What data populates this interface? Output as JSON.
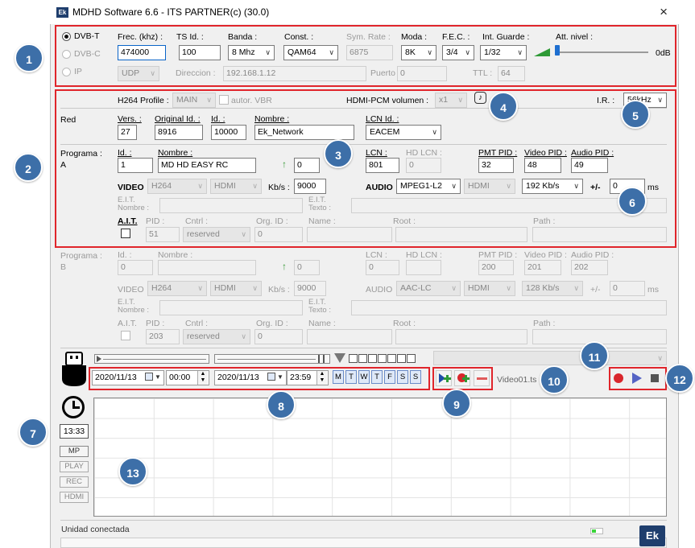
{
  "window": {
    "title": "MDHD Software 6.6 - ITS PARTNER(c) (30.0)",
    "logo": "Ek",
    "close": "×"
  },
  "badges": [
    "1",
    "2",
    "3",
    "4",
    "5",
    "6",
    "7",
    "8",
    "9",
    "10",
    "11",
    "12",
    "13"
  ],
  "tuner": {
    "modes": [
      "DVB-T",
      "DVB-C",
      "IP"
    ],
    "frec_label": "Frec. (khz) :",
    "frec_value": "474000",
    "ts_label": "TS Id. :",
    "ts_value": "100",
    "banda_label": "Banda :",
    "banda_value": "8 Mhz",
    "const_label": "Const. :",
    "const_value": "QAM64",
    "symrate_label": "Sym. Rate :",
    "symrate_value": "6875",
    "moda_label": "Moda :",
    "moda_value": "8K",
    "fec_label": "F.E.C. :",
    "fec_value": "3/4",
    "guard_label": "Int. Guarde :",
    "guard_value": "1/32",
    "att_label": "Att. nivel :",
    "att_value": "0dB",
    "att_level": 0,
    "proto_value": "UDP",
    "direccion_label": "Direccion :",
    "direccion_value": "192.168.1.12",
    "puerto_label": "Puerto",
    "puerto_value": "0",
    "ttl_label": "TTL :",
    "ttl_value": "64"
  },
  "encoder": {
    "h264_label": "H264 Profile :",
    "h264_value": "MAIN",
    "vbr_label": "autor. VBR",
    "hdmipcm_label": "HDMI-PCM volumen :",
    "hdmipcm_value": "x1",
    "ir_label": "I.R. :",
    "ir_value": "56kHz"
  },
  "red": {
    "label": "Red",
    "vers_label": "Vers. :",
    "vers_value": "27",
    "orig_label": "Original Id. :",
    "orig_value": "8916",
    "id_label": "Id. :",
    "id_value": "10000",
    "nombre_label": "Nombre :",
    "nombre_value": "Ek_Network",
    "lcnid_label": "LCN Id. :",
    "lcnid_value": "EACEM"
  },
  "programa_a": {
    "label": "Programa :",
    "letter": "A",
    "id_label": "Id. :",
    "id_value": "1",
    "nombre_label": "Nombre :",
    "nombre_value": "MD HD EASY RC",
    "extra_value": "0",
    "lcn_label": "LCN :",
    "lcn_value": "801",
    "hdlcn_label": "HD LCN :",
    "hdlcn_value": "0",
    "pmt_label": "PMT PID :",
    "pmt_value": "32",
    "video_pid_label": "Video PID :",
    "video_pid_value": "48",
    "audio_pid_label": "Audio PID :",
    "audio_pid_value": "49",
    "video_label": "VIDEO",
    "video_codec": "H264",
    "video_src": "HDMI",
    "kbs_label": "Kb/s :",
    "kbs_value": "9000",
    "audio_label": "AUDIO",
    "audio_codec": "MPEG1-L2",
    "audio_src": "HDMI",
    "audio_rate": "192 Kb/s",
    "pm_label": "+/-",
    "pm_value": "0",
    "ms_label": "ms",
    "eit_nombre": "E.I.T.\nNombre :",
    "eit_texto": "E.I.T.\nTexto :",
    "ait_label": "A.I.T.",
    "pid_label": "PID :",
    "pid_value": "51",
    "cntrl_label": "Cntrl :",
    "cntrl_value": "reserved",
    "org_label": "Org. ID :",
    "org_value": "0",
    "name_label": "Name :",
    "root_label": "Root :",
    "path_label": "Path :"
  },
  "programa_b": {
    "label": "Programa :",
    "letter": "B",
    "id_label": "Id. :",
    "id_value": "0",
    "nombre_label": "Nombre :",
    "extra_value": "0",
    "lcn_label": "LCN :",
    "lcn_value": "0",
    "hdlcn_label": "HD LCN :",
    "pmt_label": "PMT PID :",
    "pmt_value": "200",
    "video_pid_label": "Video PID :",
    "video_pid_value": "201",
    "audio_pid_label": "Audio PID :",
    "audio_pid_value": "202",
    "video_label": "VIDEO",
    "video_codec": "H264",
    "video_src": "HDMI",
    "kbs_label": "Kb/s :",
    "kbs_value": "9000",
    "audio_label": "AUDIO",
    "audio_codec": "AAC-LC",
    "audio_src": "HDMI",
    "audio_rate": "128 Kb/s",
    "pm_label": "+/-",
    "pm_value": "0",
    "ms_label": "ms",
    "eit_nombre": "E.I.T.\nNombre :",
    "eit_texto": "E.I.T.\nTexto :",
    "ait_label": "A.I.T.",
    "pid_label": "PID :",
    "pid_value": "203",
    "cntrl_label": "Cntrl :",
    "cntrl_value": "reserved",
    "org_label": "Org. ID :",
    "org_value": "0",
    "name_label": "Name :",
    "root_label": "Root :",
    "path_label": "Path :"
  },
  "schedule": {
    "start_date": "2020/11/13",
    "start_time": "00:00",
    "end_date": "2020/11/13",
    "end_time": "23:59",
    "days": [
      "M",
      "T",
      "W",
      "T",
      "F",
      "S",
      "S"
    ],
    "file": "Video01.ts"
  },
  "side": {
    "clock": "13:33",
    "buttons": [
      "MP",
      "PLAY",
      "REC",
      "HDMI"
    ]
  },
  "status": {
    "text": "Unidad conectada",
    "logo": "Ek"
  },
  "colors": {
    "accent_red": "#e0252b",
    "badge_blue": "#3d6fa8",
    "brand": "#1f3e6d"
  }
}
